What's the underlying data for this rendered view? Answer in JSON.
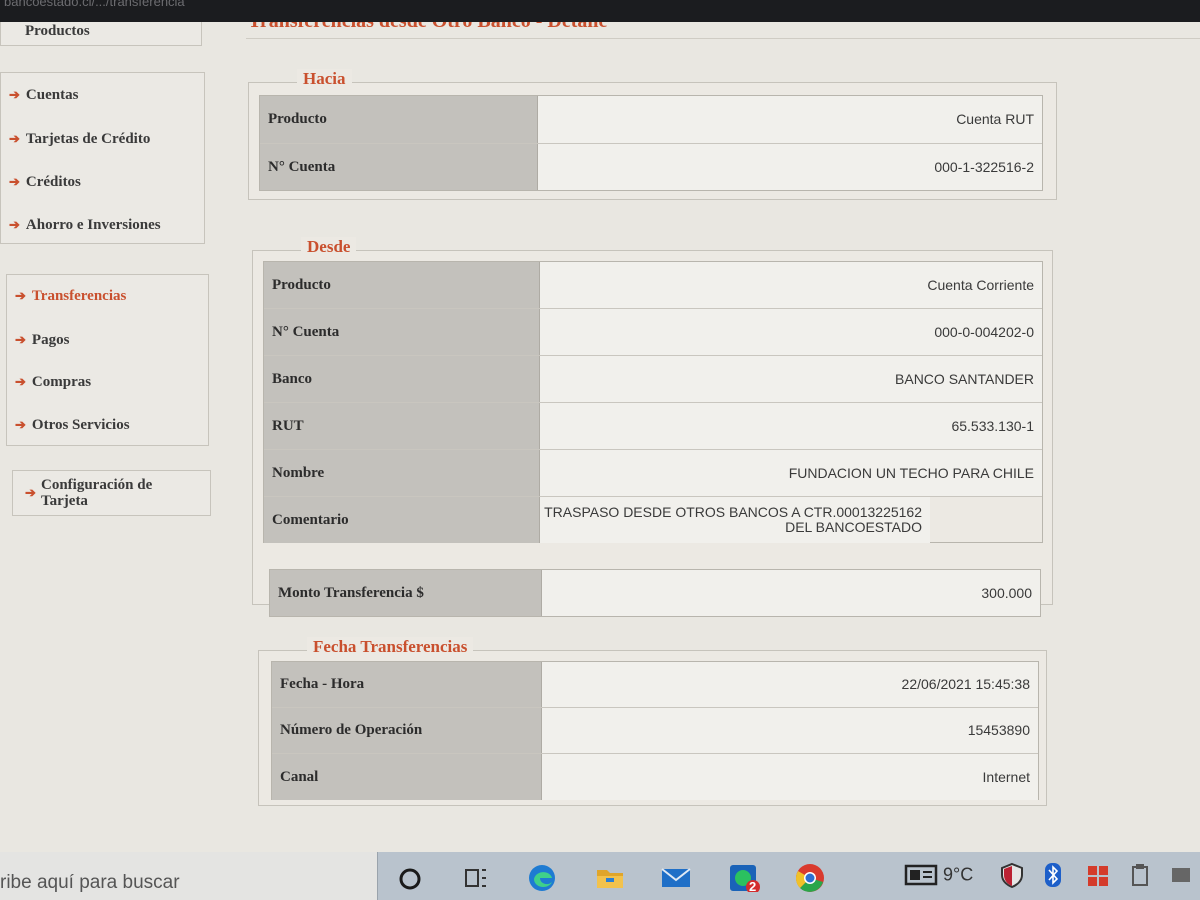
{
  "window": {
    "url": "bancoestado.cl/.../transferencia",
    "page_title": "Transferencias desde Otro Banco - Detalle"
  },
  "sidebar": {
    "top_item": "Productos",
    "group1": [
      "Cuentas",
      "Tarjetas de Crédito",
      "Créditos",
      "Ahorro e Inversiones"
    ],
    "group2": [
      "Transferencias",
      "Pagos",
      "Compras",
      "Otros Servicios"
    ],
    "group3_line1": "Configuración de",
    "group3_line2": "Tarjeta"
  },
  "hacia": {
    "legend": "Hacia",
    "rows": [
      {
        "label": "Producto",
        "value": "Cuenta RUT"
      },
      {
        "label": "N° Cuenta",
        "value": "000-1-322516-2"
      }
    ]
  },
  "desde": {
    "legend": "Desde",
    "rows": [
      {
        "label": "Producto",
        "value": "Cuenta Corriente"
      },
      {
        "label": "N° Cuenta",
        "value": "000-0-004202-0"
      },
      {
        "label": "Banco",
        "value": "BANCO SANTANDER"
      },
      {
        "label": "RUT",
        "value": "65.533.130-1"
      },
      {
        "label": "Nombre",
        "value": "FUNDACION UN TECHO PARA CHILE"
      },
      {
        "label": "Comentario",
        "value": "TRASPASO DESDE OTROS BANCOS A CTR.00013225162 DEL BANCOESTADO"
      }
    ],
    "monto_label": "Monto Transferencia $",
    "monto_value": "300.000"
  },
  "fecha": {
    "legend": "Fecha Transferencias",
    "rows": [
      {
        "label": "Fecha - Hora",
        "value": "22/06/2021 15:45:38"
      },
      {
        "label": "Número de Operación",
        "value": "15453890"
      },
      {
        "label": "Canal",
        "value": "Internet"
      }
    ]
  },
  "taskbar": {
    "search_text": "ribe aquí para buscar",
    "whatsapp_badge": "2",
    "temperature": "9°C",
    "icons": [
      "cortana-icon",
      "task-view-icon",
      "edge-icon",
      "file-explorer-icon",
      "mail-icon",
      "whatsapp-icon",
      "chrome-icon"
    ]
  },
  "colors": {
    "accent": "#c9502e",
    "label_bg": "#c3c1bc",
    "value_bg": "#f1f0ec"
  }
}
